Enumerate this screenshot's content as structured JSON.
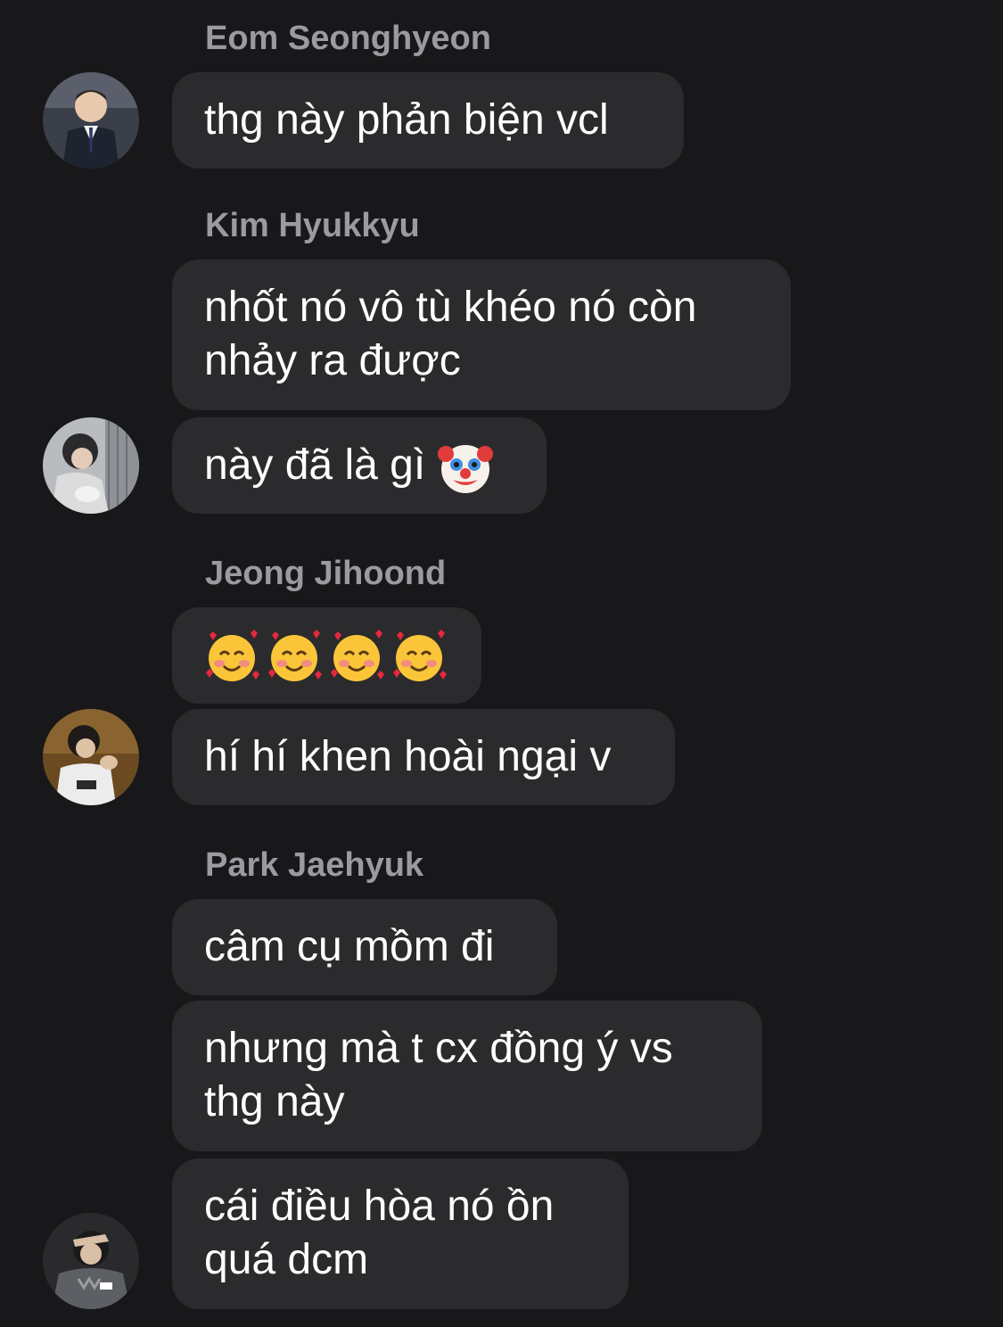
{
  "thread": {
    "groups": [
      {
        "sender": "Eom Seonghyeon",
        "messages": [
          {
            "lines": [
              "thg này phản biện vcl"
            ]
          }
        ]
      },
      {
        "sender": "Kim Hyukkyu",
        "messages": [
          {
            "lines": [
              "nhốt nó vô tù khéo nó còn",
              "nhảy ra được"
            ]
          },
          {
            "text": "này đã là gì",
            "emoji": "clown-face"
          }
        ]
      },
      {
        "sender": "Jeong Jihoond",
        "messages": [
          {
            "emoji": "smiling-face-with-hearts",
            "emoji_count": 4
          },
          {
            "lines": [
              "hí hí khen hoài ngại v"
            ]
          }
        ]
      },
      {
        "sender": "Park Jaehyuk",
        "messages": [
          {
            "lines": [
              "câm cụ mồm đi"
            ]
          },
          {
            "lines": [
              "nhưng mà t cx đồng ý vs",
              "thg này"
            ]
          },
          {
            "lines": [
              "cái điều hòa nó ồn",
              "quá dcm"
            ]
          }
        ]
      }
    ]
  },
  "colors": {
    "background": "#18181a",
    "bubble": "#2b2b2d",
    "sender_name": "#9a9a9f",
    "message_text": "#ffffff"
  }
}
